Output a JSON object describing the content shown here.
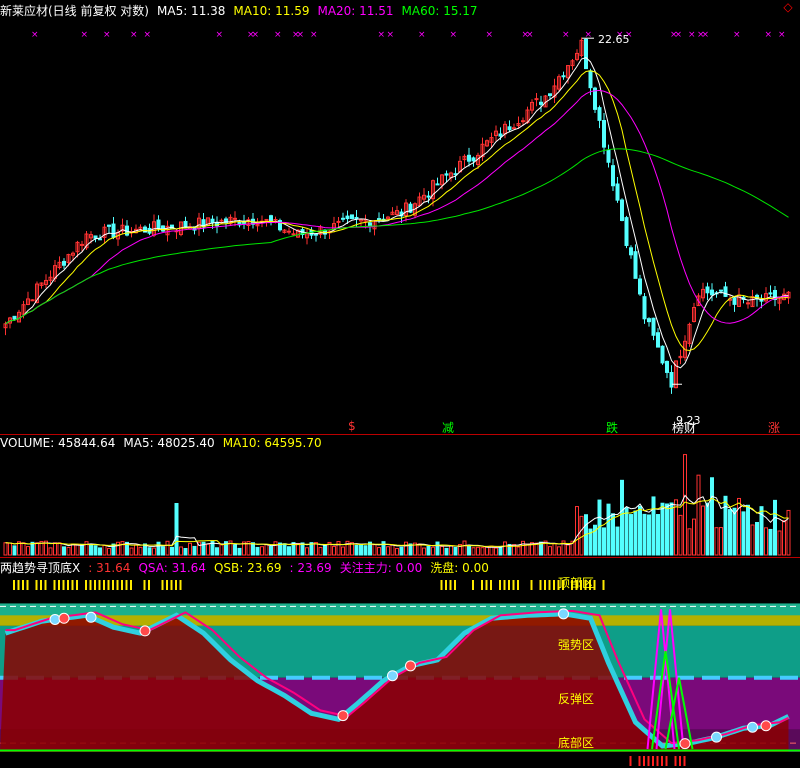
{
  "main_header": {
    "title": "新莱应材(日线 前复权 对数)",
    "ma5": "MA5: 11.38",
    "ma10": "MA10: 11.59",
    "ma20": "MA20: 11.51",
    "ma60": "MA60: 15.17"
  },
  "volume_header": {
    "title": "VOLUME: 45844.64",
    "ma5": "MA5: 48025.40",
    "ma10": "MA10: 64595.70"
  },
  "indicator_header": {
    "title": "两趋势寻顶底X",
    "v1": ": 31.64",
    "qsa": "QSA: 31.64",
    "qsb": "QSB: 23.69",
    "v2": ": 23.69",
    "main_force": "关注主力: 0.00",
    "wash": "洗盘: 0.00"
  },
  "annotations": {
    "high_price": "22.65",
    "low_price": "9.23",
    "signal_1": "$",
    "signal_2": "减",
    "signal_3": "跌",
    "signal_4": "榜财",
    "signal_5": "涨"
  },
  "zones": {
    "top": "顶部区",
    "strong": "强势区",
    "rebound": "反弹区",
    "bottom": "底部区"
  },
  "colors": {
    "up": "#ff3232",
    "down": "#54ffff",
    "ma5": "#ffffff",
    "ma10": "#ffff00",
    "ma20": "#ff00ff",
    "ma60": "#00e600",
    "background": "#000000"
  },
  "chart_data": [
    {
      "type": "candlestick",
      "title": "新莱应材(日线 前复权 对数)",
      "scale": "log",
      "ylim": [
        8.5,
        23.5
      ],
      "marked_high": 22.65,
      "marked_low": 9.23,
      "phases": [
        {
          "start": 0,
          "end": 18,
          "from": 10.8,
          "to": 13.6
        },
        {
          "start": 18,
          "end": 56,
          "from": 13.6,
          "to": 14.2
        },
        {
          "start": 56,
          "end": 65,
          "from": 14.2,
          "to": 13.6
        },
        {
          "start": 65,
          "end": 88,
          "from": 13.6,
          "to": 14.4
        },
        {
          "start": 88,
          "end": 120,
          "from": 14.4,
          "to": 19.5
        },
        {
          "start": 120,
          "end": 128,
          "from": 19.5,
          "to": 22.3
        },
        {
          "start": 128,
          "end": 142,
          "from": 22.3,
          "to": 11.0
        },
        {
          "start": 142,
          "end": 148,
          "from": 11.0,
          "to": 9.3
        },
        {
          "start": 148,
          "end": 154,
          "from": 9.3,
          "to": 11.8
        },
        {
          "start": 154,
          "end": 165,
          "from": 11.8,
          "to": 11.4
        },
        {
          "start": 165,
          "end": 174,
          "from": 11.4,
          "to": 11.6
        }
      ],
      "series": [
        {
          "name": "MA5",
          "value": 11.38
        },
        {
          "name": "MA10",
          "value": 11.59
        },
        {
          "name": "MA20",
          "value": 11.51
        },
        {
          "name": "MA60",
          "value": 15.17
        }
      ]
    },
    {
      "type": "bar",
      "title": "VOLUME",
      "last_value": 45844.64,
      "ylim": [
        0,
        80000
      ],
      "series": [
        {
          "name": "MA5",
          "value": 48025.4
        },
        {
          "name": "MA10",
          "value": 64595.7
        }
      ],
      "spikes": [
        {
          "index": 38,
          "value": 40000
        },
        {
          "index": 128,
          "value": 30000
        },
        {
          "index": 137,
          "value": 58000
        },
        {
          "index": 151,
          "value": 78000
        },
        {
          "index": 154,
          "value": 62000
        },
        {
          "index": 157,
          "value": 60000
        }
      ]
    },
    {
      "type": "line",
      "title": "两趋势寻顶底X",
      "ylim": [
        0,
        105
      ],
      "bands": [
        {
          "label": "顶部区",
          "from": 85,
          "to": 100
        },
        {
          "label": "强势区",
          "from": 50,
          "to": 85
        },
        {
          "label": "反弹区",
          "from": 15,
          "to": 50
        },
        {
          "label": "底部区",
          "from": 0,
          "to": 15
        }
      ],
      "series": [
        {
          "name": "QSA",
          "value": 31.64,
          "path": [
            [
              0,
              80
            ],
            [
              8,
              88
            ],
            [
              18,
              92
            ],
            [
              24,
              84
            ],
            [
              30,
              80
            ],
            [
              38,
              92
            ],
            [
              44,
              80
            ],
            [
              50,
              62
            ],
            [
              56,
              48
            ],
            [
              62,
              38
            ],
            [
              68,
              26
            ],
            [
              74,
              22
            ],
            [
              78,
              32
            ],
            [
              84,
              48
            ],
            [
              90,
              58
            ],
            [
              96,
              62
            ],
            [
              102,
              80
            ],
            [
              108,
              90
            ],
            [
              116,
              92
            ],
            [
              124,
              93
            ],
            [
              130,
              90
            ],
            [
              134,
              60
            ],
            [
              140,
              20
            ],
            [
              146,
              4
            ],
            [
              152,
              6
            ],
            [
              158,
              10
            ],
            [
              164,
              16
            ],
            [
              170,
              18
            ],
            [
              174,
              24
            ]
          ]
        },
        {
          "name": "QSB",
          "value": 23.69
        },
        {
          "name": "关注主力",
          "value": 0.0
        },
        {
          "name": "洗盘",
          "value": 0.0
        }
      ]
    }
  ]
}
